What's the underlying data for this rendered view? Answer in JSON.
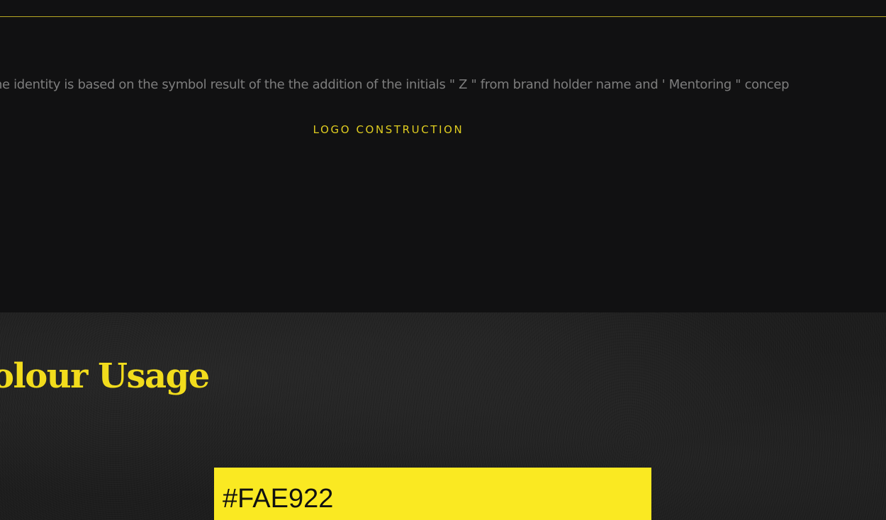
{
  "intro": {
    "description": "he identity is based on the symbol result of the the addition of the initials \" Z \" from brand holder name and  ' Mentoring \" concep"
  },
  "logo_construction": {
    "label": "LOGO CONSTRUCTION"
  },
  "colour_usage": {
    "title": "olour Usage",
    "swatches": [
      {
        "code": "#FAE922",
        "color": "#FAE922"
      }
    ]
  },
  "colors": {
    "accent": "#E0CD20",
    "background": "#111112",
    "texture_background": "#1D1D1D"
  }
}
